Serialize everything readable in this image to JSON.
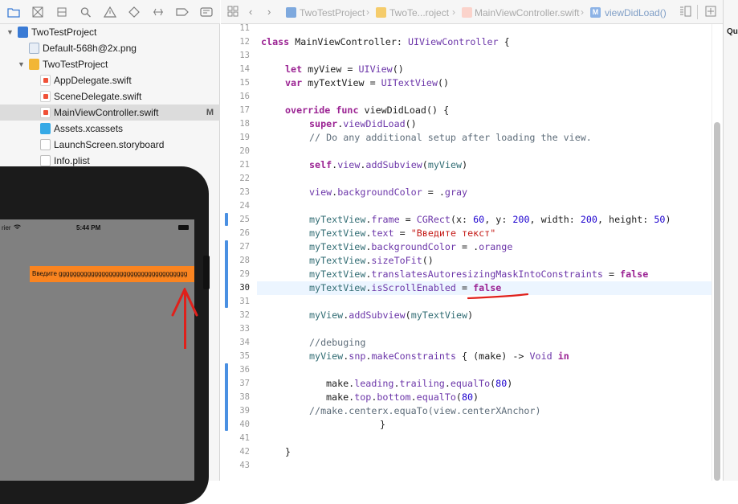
{
  "navigator": {
    "toolbar_icons": [
      "folder-icon",
      "source-control-icon",
      "symbol-icon",
      "search-icon",
      "issue-icon",
      "test-icon",
      "debug-icon",
      "breakpoint-icon",
      "report-icon"
    ],
    "items": [
      {
        "label": "TwoTestProject",
        "icon": "project-icon",
        "badge": ""
      },
      {
        "label": "Default-568h@2x.png",
        "icon": "image-file-icon",
        "badge": ""
      },
      {
        "label": "TwoTestProject",
        "icon": "folder-icon",
        "badge": ""
      },
      {
        "label": "AppDelegate.swift",
        "icon": "swift-file-icon",
        "badge": ""
      },
      {
        "label": "SceneDelegate.swift",
        "icon": "swift-file-icon",
        "badge": ""
      },
      {
        "label": "MainViewController.swift",
        "icon": "swift-file-icon",
        "badge": "M",
        "selected": true
      },
      {
        "label": "Assets.xcassets",
        "icon": "assets-icon",
        "badge": ""
      },
      {
        "label": "LaunchScreen.storyboard",
        "icon": "storyboard-icon",
        "badge": ""
      },
      {
        "label": "Info.plist",
        "icon": "plist-icon",
        "badge": ""
      }
    ]
  },
  "simulator": {
    "carrier": "rier",
    "time": "5:44 PM",
    "textview_text": "Введите gggggggggggggggggggggggggggggggggggg"
  },
  "editor": {
    "breadcrumbs": [
      "TwoTestProject",
      "TwoTe...roject",
      "MainViewController.swift",
      "viewDidLoad()"
    ],
    "method_badge": "M",
    "current_line": 30,
    "line_numbers": [
      11,
      12,
      13,
      14,
      15,
      16,
      17,
      18,
      19,
      20,
      21,
      22,
      23,
      24,
      25,
      26,
      27,
      28,
      29,
      30,
      31,
      32,
      33,
      34,
      35,
      36,
      37,
      38,
      39,
      40,
      41,
      42,
      43
    ],
    "code": {
      "l11": {
        "a": "class",
        "b": " MainViewController",
        "c": ": ",
        "d": "UIViewController",
        "e": " {"
      },
      "l14": {
        "a": "let",
        "b": " myView = ",
        "c": "UIView",
        "d": "()"
      },
      "l15": {
        "a": "var",
        "b": " myTextView = ",
        "c": "UITextView",
        "d": "()"
      },
      "l17": {
        "a": "override",
        "b": " ",
        "c": "func",
        "d": " viewDidLoad",
        "e": "() {"
      },
      "l18": {
        "a": "super",
        "b": ".",
        "c": "viewDidLoad",
        "d": "()"
      },
      "l19": {
        "a": "// Do any additional setup after loading the view."
      },
      "l21": {
        "a": "self",
        "b": ".",
        "c": "view",
        "d": ".",
        "e": "addSubview",
        "f": "(",
        "g": "myView",
        "h": ")"
      },
      "l23": {
        "a": "view",
        "b": ".",
        "c": "backgroundColor",
        "d": " = .",
        "e": "gray"
      },
      "l25": {
        "a": "myTextView",
        "b": ".",
        "c": "frame",
        "d": " = ",
        "e": "CGRect",
        "f": "(x: ",
        "g": "60",
        "h": ", y: ",
        "i": "200",
        "j": ", width: ",
        "k": "200",
        "l": ", height: ",
        "m": "50",
        "n": ")"
      },
      "l26": {
        "a": "myTextView",
        "b": ".",
        "c": "text",
        "d": " = ",
        "e": "\"Введите текст\""
      },
      "l27": {
        "a": "myTextView",
        "b": ".",
        "c": "backgroundColor",
        "d": " = .",
        "e": "orange"
      },
      "l28": {
        "a": "myTextView",
        "b": ".",
        "c": "sizeToFit",
        "d": "()"
      },
      "l29": {
        "a": "myTextView",
        "b": ".",
        "c": "translatesAutoresizingMaskIntoConstraints",
        "d": " = ",
        "e": "false"
      },
      "l30": {
        "a": "myTextView",
        "b": ".",
        "c": "isScrollEnabled",
        "d": " = ",
        "e": "false"
      },
      "l32": {
        "a": "myView",
        "b": ".",
        "c": "addSubview",
        "d": "(",
        "e": "myTextView",
        "f": ")"
      },
      "l34": {
        "a": "//debuging"
      },
      "l35": {
        "a": "myView",
        "b": ".",
        "c": "snp",
        "d": ".",
        "e": "makeConstraints",
        "f": " { (make) -> ",
        "g": "Void",
        "h": " ",
        "i": "in"
      },
      "l37": {
        "a": "make",
        "b": ".",
        "c": "leading",
        "d": ".",
        "e": "trailing",
        "f": ".",
        "g": "equalTo",
        "h": "(",
        "i": "80",
        "j": ")"
      },
      "l38": {
        "a": "make",
        "b": ".",
        "c": "top",
        "d": ".",
        "e": "bottom",
        "f": ".",
        "g": "equalTo",
        "h": "(",
        "i": "80",
        "j": ")"
      },
      "l39": {
        "a": "//make.centerx.equaTo(view.centerXAnchor)"
      },
      "l40": {
        "a": "}"
      },
      "l42": {
        "a": "}"
      }
    }
  },
  "inspector": {
    "label": "Qu"
  },
  "colors": {
    "keyword": "#9b2393",
    "string": "#c41a16",
    "number": "#1c00cf",
    "member": "#6c36a9",
    "annotation_red": "#e0201b",
    "change_bar": "#4a90e2",
    "textview_orange": "#fa8420"
  }
}
